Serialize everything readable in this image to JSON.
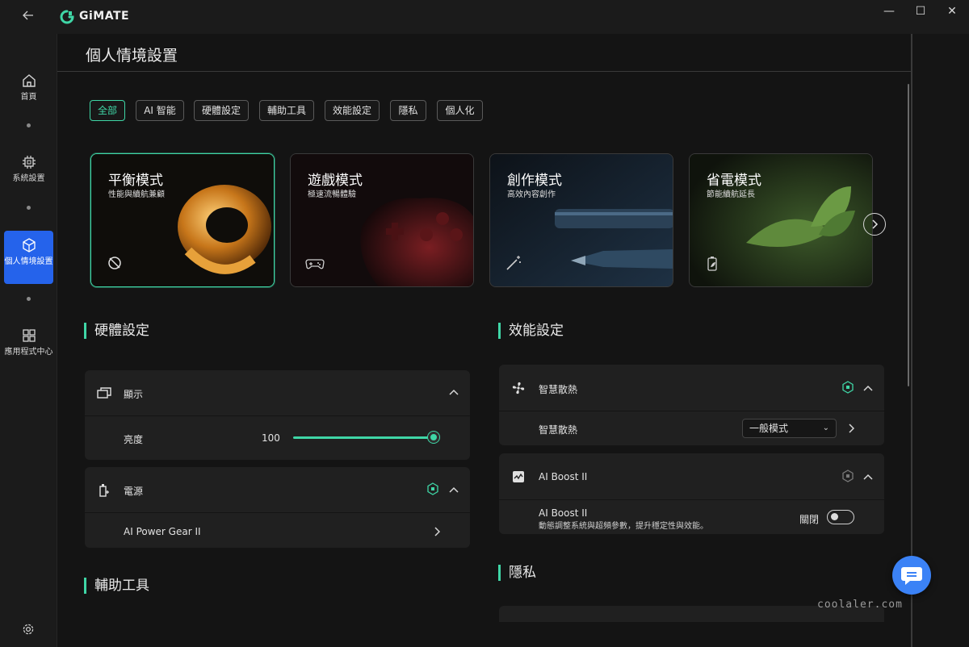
{
  "app": {
    "brand": "GiMATE",
    "back_icon": "arrow-left-icon"
  },
  "window_controls": {
    "minimize": "—",
    "maximize": "☐",
    "close": "✕"
  },
  "sidebar": {
    "items": [
      {
        "label": "首頁",
        "icon": "home-icon"
      },
      {
        "label": "系統設置",
        "icon": "chip-icon"
      },
      {
        "label": "個人情境設置",
        "icon": "cube-icon",
        "active": true
      },
      {
        "label": "應用程式中心",
        "icon": "apps-grid-icon"
      }
    ],
    "settings_icon": "gear-icon"
  },
  "page": {
    "title": "個人情境設置"
  },
  "filters": [
    "全部",
    "AI 智能",
    "硬體設定",
    "輔助工具",
    "效能設定",
    "隱私",
    "個人化"
  ],
  "active_filter": "全部",
  "modes": [
    {
      "title": "平衡模式",
      "subtitle": "性能與續航兼顧",
      "icon": "balance-icon",
      "active": true
    },
    {
      "title": "遊戲模式",
      "subtitle": "極速流暢體驗",
      "icon": "gamepad-icon"
    },
    {
      "title": "創作模式",
      "subtitle": "高效內容創作",
      "icon": "magic-wand-icon"
    },
    {
      "title": "省電模式",
      "subtitle": "節能續航延長",
      "icon": "battery-leaf-icon"
    }
  ],
  "hardware": {
    "heading": "硬體設定",
    "display": {
      "label": "顯示",
      "brightness_label": "亮度",
      "brightness_value": "100"
    },
    "power": {
      "label": "電源",
      "gear_label": "AI Power Gear II"
    }
  },
  "performance": {
    "heading": "效能設定",
    "cooling": {
      "label": "智慧散熱",
      "row_label": "智慧散熱",
      "mode": "一般模式"
    },
    "boost": {
      "label": "AI Boost II",
      "row_title": "AI Boost II",
      "row_desc": "動態調整系統與超頻參數，提升穩定性與效能。",
      "state": "關閉"
    }
  },
  "accessibility": {
    "heading": "輔助工具"
  },
  "privacy": {
    "heading": "隱私"
  },
  "watermark": "coolaler.com",
  "colors": {
    "accent": "#3fd6a6",
    "active_nav": "#2563eb",
    "fab": "#3b82f6"
  }
}
